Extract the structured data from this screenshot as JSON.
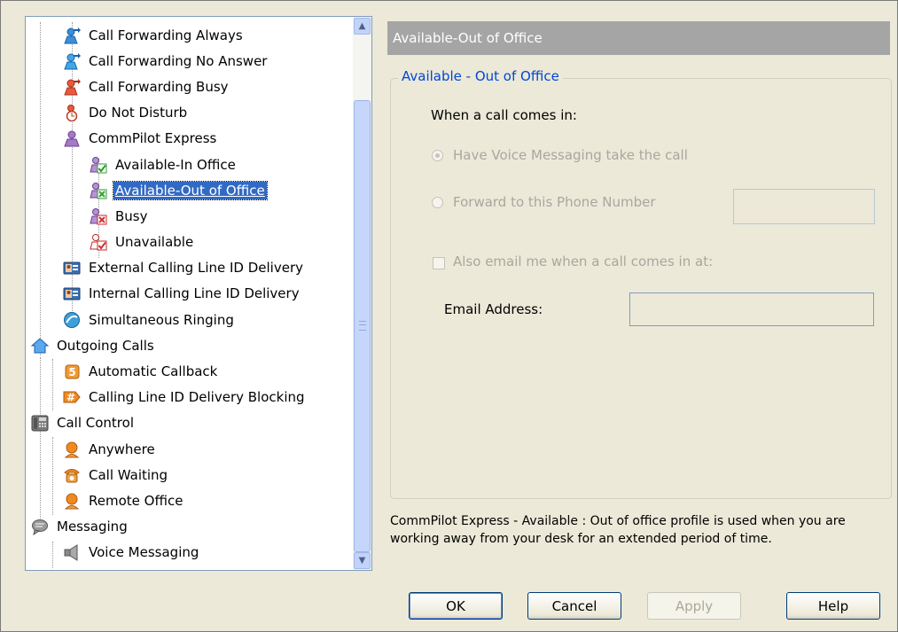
{
  "tree": {
    "items": [
      {
        "label": "Call Forwarding Always",
        "icon": "person-forward-icon"
      },
      {
        "label": "Call Forwarding No Answer",
        "icon": "person-forward-no-answer-icon"
      },
      {
        "label": "Call Forwarding Busy",
        "icon": "person-forward-busy-icon"
      },
      {
        "label": "Do Not Disturb",
        "icon": "person-do-not-disturb-icon"
      },
      {
        "label": "CommPilot Express",
        "icon": "person-commpilot-icon"
      },
      {
        "label": "Available-In Office",
        "icon": "person-check-icon"
      },
      {
        "label": "Available-Out of Office",
        "icon": "person-out-of-office-icon"
      },
      {
        "label": "Busy",
        "icon": "person-busy-icon"
      },
      {
        "label": "Unavailable",
        "icon": "person-unavailable-icon"
      },
      {
        "label": "External Calling Line ID Delivery",
        "icon": "id-card-icon"
      },
      {
        "label": "Internal Calling Line ID Delivery",
        "icon": "id-card-icon"
      },
      {
        "label": "Simultaneous Ringing",
        "icon": "globe-icon"
      },
      {
        "label": "Outgoing Calls",
        "icon": "house-icon"
      },
      {
        "label": "Automatic Callback",
        "icon": "callback-icon"
      },
      {
        "label": "Calling Line ID Delivery Blocking",
        "icon": "hash-block-icon"
      },
      {
        "label": "Call Control",
        "icon": "phone-icon"
      },
      {
        "label": "Anywhere",
        "icon": "orange-person-icon"
      },
      {
        "label": "Call Waiting",
        "icon": "call-waiting-icon"
      },
      {
        "label": "Remote Office",
        "icon": "orange-person-icon"
      },
      {
        "label": "Messaging",
        "icon": "speech-bubble-icon"
      },
      {
        "label": "Voice Messaging",
        "icon": "speaker-icon"
      }
    ]
  },
  "panel": {
    "header": "Available-Out of Office",
    "group_title": "Available - Out of Office",
    "when_call": "When a call comes in:",
    "radio_voice_messaging": "Have Voice Messaging take the call",
    "radio_forward": "Forward to this Phone Number",
    "forward_number_value": "",
    "also_email": "Also email me when a call comes in at:",
    "email_label": "Email Address:",
    "email_value": "",
    "description": "CommPilot Express - Available : Out of office profile is used when you are working away from your desk for an extended period of time."
  },
  "buttons": {
    "ok": "OK",
    "cancel": "Cancel",
    "apply": "Apply",
    "help": "Help"
  },
  "colors": {
    "selection": "#316ac5",
    "group_title": "#0046d5",
    "header_bar": "#a5a5a5"
  }
}
